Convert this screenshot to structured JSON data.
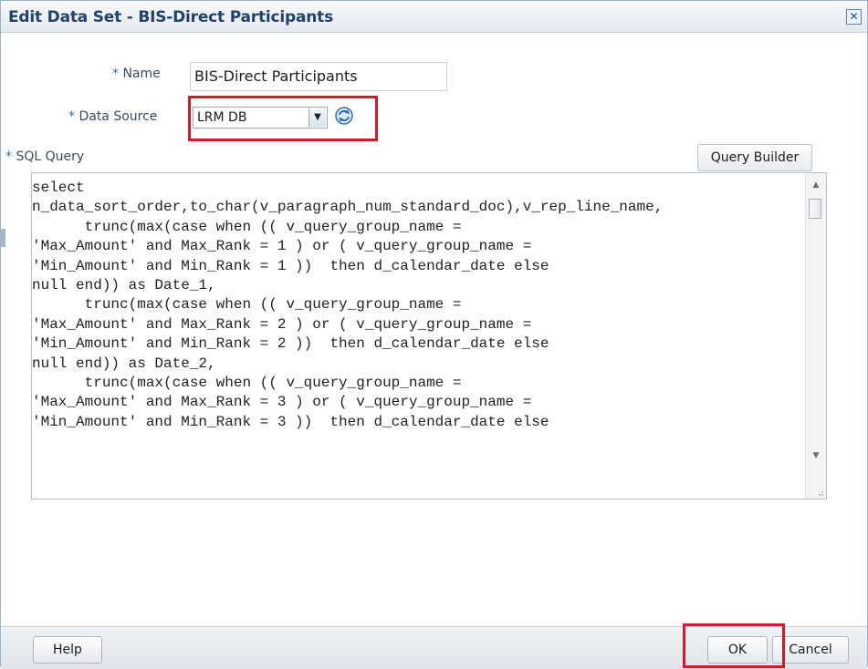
{
  "dialog": {
    "title": "Edit Data Set - BIS-Direct Participants",
    "close_symbol": "✕"
  },
  "form": {
    "name_label": "Name",
    "name_value": "BIS-Direct Participants",
    "data_source_label": "Data Source",
    "data_source_value": "LRM DB",
    "sql_query_label": "SQL Query",
    "required_marker": "*",
    "query_builder_label": "Query Builder",
    "sql_text": "select\nn_data_sort_order,to_char(v_paragraph_num_standard_doc),v_rep_line_name,\n      trunc(max(case when (( v_query_group_name =\n'Max_Amount' and Max_Rank = 1 ) or ( v_query_group_name =\n'Min_Amount' and Min_Rank = 1 ))  then d_calendar_date else\nnull end)) as Date_1,\n      trunc(max(case when (( v_query_group_name =\n'Max_Amount' and Max_Rank = 2 ) or ( v_query_group_name =\n'Min_Amount' and Min_Rank = 2 ))  then d_calendar_date else\nnull end)) as Date_2,\n      trunc(max(case when (( v_query_group_name =\n'Max_Amount' and Max_Rank = 3 ) or ( v_query_group_name =\n'Min_Amount' and Min_Rank = 3 ))  then d_calendar_date else"
  },
  "footer": {
    "help_label": "Help",
    "ok_label": "OK",
    "cancel_label": "Cancel"
  },
  "icons": {
    "close": "close-icon",
    "dropdown": "chevron-down-icon",
    "refresh": "refresh-icon"
  },
  "colors": {
    "title_text": "#23426a",
    "highlight_red": "#d01c2a",
    "required_blue": "#2b6fb0"
  }
}
